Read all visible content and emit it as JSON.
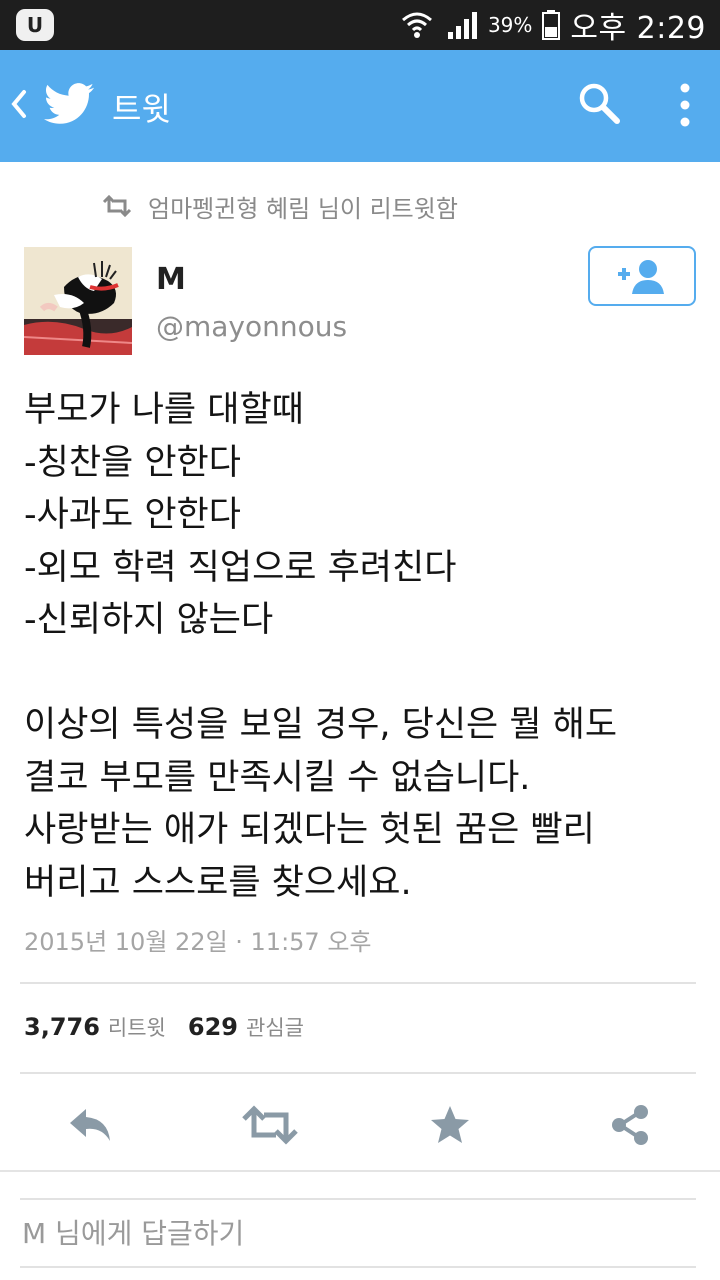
{
  "status_bar": {
    "app_badge": "U",
    "battery_percent": "39%",
    "time": "오후 2:29"
  },
  "app_bar": {
    "title": "트윗",
    "background_color": "#55acee"
  },
  "retweet_context": {
    "text": "엄마펭귄형 혜림 님이 리트윗함"
  },
  "author": {
    "name": "M",
    "handle": "@mayonnous"
  },
  "tweet": {
    "text": "부모가 나를 대할때\n-칭찬을 안한다\n-사과도 안한다\n-외모 학력 직업으로 후려친다\n-신뢰하지 않는다\n\n이상의 특성을 보일 경우, 당신은 뭘 해도\n결코 부모를 만족시킬 수 없습니다.\n사랑받는 애가 되겠다는 헛된 꿈은 빨리\n버리고 스스로를 찾으세요.",
    "timestamp": "2015년 10월 22일 · 11:57 오후"
  },
  "stats": {
    "retweet_count": "3,776",
    "retweet_label": "리트윗",
    "like_count": "629",
    "like_label": "관심글"
  },
  "reply": {
    "placeholder": "M 님에게 답글하기"
  },
  "icons": {
    "back": "chevron-left",
    "logo": "twitter-bird",
    "search": "magnifier",
    "more": "vertical-dots",
    "follow": "add-user",
    "reply": "reply-arrow",
    "retweet": "retweet-arrows",
    "favorite": "star",
    "share": "share-nodes"
  },
  "colors": {
    "accent": "#55acee",
    "action_icon": "#8a9aa6",
    "muted_text": "#8d8d8d"
  }
}
